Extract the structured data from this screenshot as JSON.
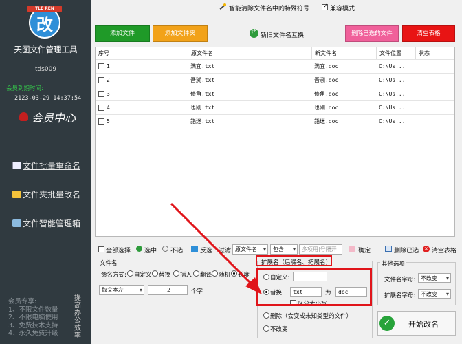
{
  "sidebar": {
    "logo_ribbon": "TLE REN",
    "logo_glyph": "改",
    "app_title": "天图文件管理工具",
    "user": "tds009",
    "member_expire_label": "会员到期时间:",
    "member_expire": "2123-03-29 14:37:54",
    "member_center": "会员中心",
    "nav": [
      {
        "label": "文件批量重命名"
      },
      {
        "label": "文件夹批量改名"
      },
      {
        "label": "文件智能管理箱"
      }
    ],
    "member_perks": [
      "会员专享:",
      "1、不限文件数量",
      "2、不限电脑使用",
      "3、免费技术支持",
      "4、永久免费升级"
    ],
    "side_vertical": "提高办公效率"
  },
  "topbar": {
    "smart_clear": "智能清除文件名中的特殊符号",
    "compat_mode": "兼容模式"
  },
  "toolbar": {
    "add_file": "添加文件",
    "add_folder": "添加文件夹",
    "swap_names": "新旧文件名互换",
    "delete_selected": "删除已选的文件",
    "clear_table": "清空表格",
    "colors": {
      "add_file": "#1f9a28",
      "add_folder": "#f2a219",
      "delete_selected": "#f0609a",
      "clear_table": "#e81414"
    }
  },
  "table": {
    "headers": [
      "序号",
      "原文件名",
      "新文件名",
      "文件位置",
      "状态"
    ],
    "rows": [
      {
        "index": "1",
        "old": "满宜.txt",
        "new": "满宜.doc",
        "location": "C:\\Us..."
      },
      {
        "index": "2",
        "old": "吾溯.txt",
        "new": "吾溯.doc",
        "location": "C:\\Us..."
      },
      {
        "index": "3",
        "old": "债角.txt",
        "new": "债角.doc",
        "location": "C:\\Us..."
      },
      {
        "index": "4",
        "old": "也刚.txt",
        "new": "也刚.doc",
        "location": "C:\\Us..."
      },
      {
        "index": "5",
        "old": "詣迷.txt",
        "new": "詣迷.doc",
        "location": "C:\\Us..."
      }
    ]
  },
  "selbar": {
    "select_all": "全部选择",
    "select": "选中",
    "unselect": "不选",
    "invert": "反选",
    "filter_label": "过滤:",
    "filter_field": "原文件名",
    "filter_mode": "包含",
    "filter_placeholder": "多项用|号隔开",
    "confirm": "确定",
    "delete_selected": "删除已选",
    "clear_table": "清空表格"
  },
  "filename": {
    "title": "文件名",
    "mode_label": "命名方式:",
    "modes": [
      "自定义",
      "替换",
      "插入",
      "翻译",
      "随机",
      "长度"
    ],
    "sub_mode": "取文本左",
    "length_value": "2",
    "length_unit": "个字"
  },
  "extension": {
    "title": "扩展名（后缀名、拓展名）",
    "custom_label": "自定义:",
    "replace_label": "替换:",
    "replace_from": "txt",
    "as_label": "为",
    "replace_to": "doc",
    "case_label": "区分大小写",
    "delete_label": "删除（会变成未知类型的文件）",
    "keep_label": "不改变"
  },
  "other": {
    "title": "其他选项",
    "filename_case_label": "文件名字母:",
    "filename_case": "不改变",
    "ext_case_label": "扩展名字母:",
    "ext_case": "不改变",
    "start_button": "开始改名"
  }
}
